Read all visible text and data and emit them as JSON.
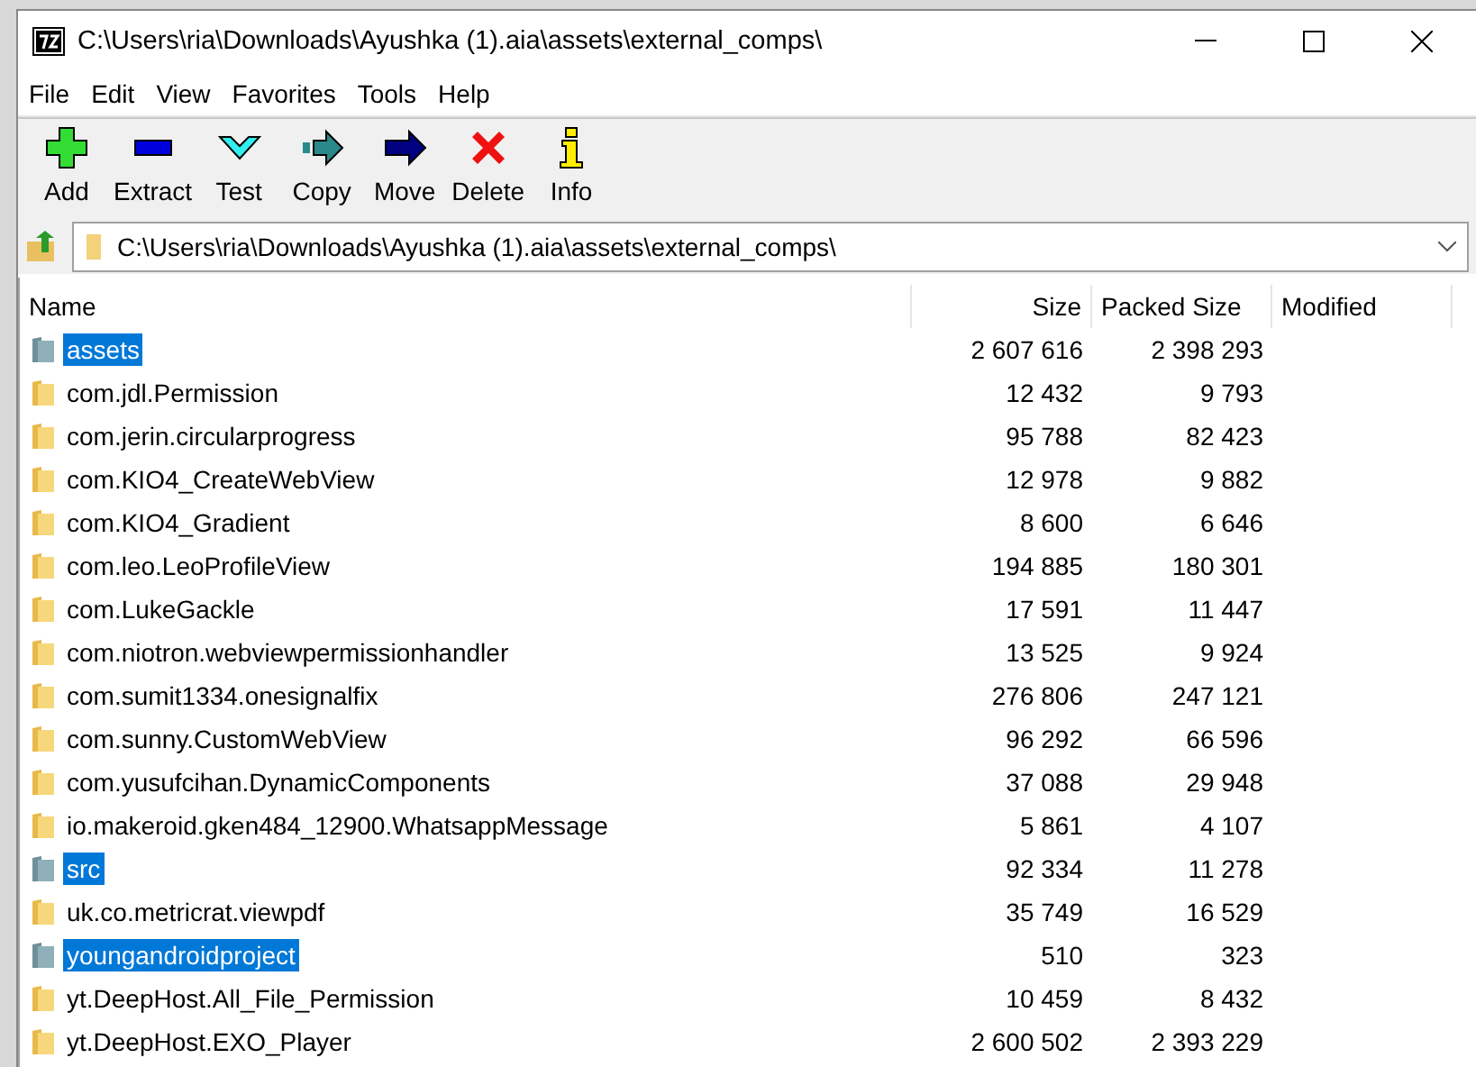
{
  "window": {
    "title": "C:\\Users\\ria\\Downloads\\Ayushka (1).aia\\assets\\external_comps\\"
  },
  "menu": [
    "File",
    "Edit",
    "View",
    "Favorites",
    "Tools",
    "Help"
  ],
  "toolbar": [
    {
      "kind": "add",
      "label": "Add"
    },
    {
      "kind": "extract",
      "label": "Extract"
    },
    {
      "kind": "test",
      "label": "Test"
    },
    {
      "kind": "copy",
      "label": "Copy"
    },
    {
      "kind": "move",
      "label": "Move"
    },
    {
      "kind": "delete",
      "label": "Delete"
    },
    {
      "kind": "info",
      "label": "Info"
    }
  ],
  "address": {
    "value": "C:\\Users\\ria\\Downloads\\Ayushka (1).aia\\assets\\external_comps\\"
  },
  "table": {
    "columns": [
      "Name",
      "Size",
      "Packed Size",
      "Modified"
    ],
    "rows": [
      {
        "name": "assets",
        "size": "2 607 616",
        "packed": "2 398 293",
        "selected": true
      },
      {
        "name": "com.jdl.Permission",
        "size": "12 432",
        "packed": "9 793",
        "selected": false
      },
      {
        "name": "com.jerin.circularprogress",
        "size": "95 788",
        "packed": "82 423",
        "selected": false
      },
      {
        "name": "com.KIO4_CreateWebView",
        "size": "12 978",
        "packed": "9 882",
        "selected": false
      },
      {
        "name": "com.KIO4_Gradient",
        "size": "8 600",
        "packed": "6 646",
        "selected": false
      },
      {
        "name": "com.leo.LeoProfileView",
        "size": "194 885",
        "packed": "180 301",
        "selected": false
      },
      {
        "name": "com.LukeGackle",
        "size": "17 591",
        "packed": "11 447",
        "selected": false
      },
      {
        "name": "com.niotron.webviewpermissionhandler",
        "size": "13 525",
        "packed": "9 924",
        "selected": false
      },
      {
        "name": "com.sumit1334.onesignalfix",
        "size": "276 806",
        "packed": "247 121",
        "selected": false
      },
      {
        "name": "com.sunny.CustomWebView",
        "size": "96 292",
        "packed": "66 596",
        "selected": false
      },
      {
        "name": "com.yusufcihan.DynamicComponents",
        "size": "37 088",
        "packed": "29 948",
        "selected": false
      },
      {
        "name": "io.makeroid.gken484_12900.WhatsappMessage",
        "size": "5 861",
        "packed": "4 107",
        "selected": false
      },
      {
        "name": "src",
        "size": "92 334",
        "packed": "11 278",
        "selected": true
      },
      {
        "name": "uk.co.metricrat.viewpdf",
        "size": "35 749",
        "packed": "16 529",
        "selected": false
      },
      {
        "name": "youngandroidproject",
        "size": "510",
        "packed": "323",
        "selected": true
      },
      {
        "name": "yt.DeepHost.All_File_Permission",
        "size": "10 459",
        "packed": "8 432",
        "selected": false
      },
      {
        "name": "yt.DeepHost.EXO_Player",
        "size": "2 600 502",
        "packed": "2 393 229",
        "selected": false
      }
    ]
  }
}
